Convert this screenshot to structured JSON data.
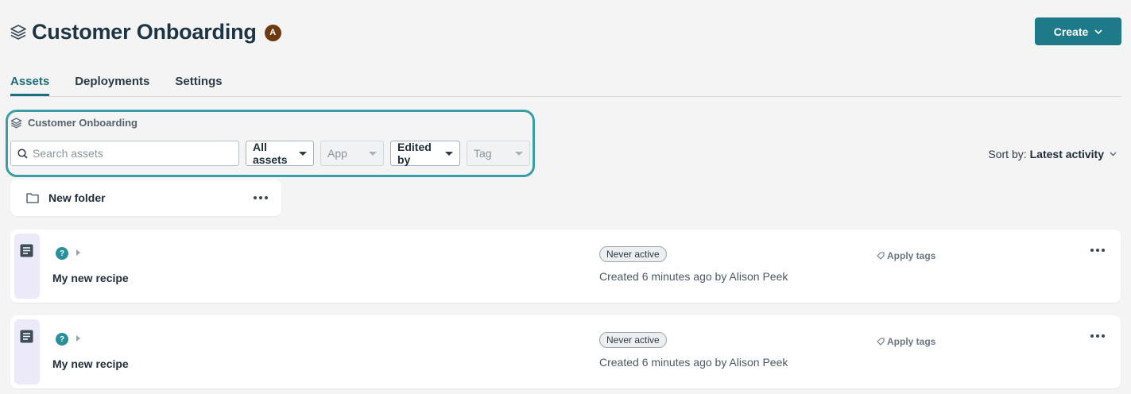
{
  "header": {
    "title": "Customer Onboarding",
    "avatar_initial": "A",
    "create_label": "Create"
  },
  "tabs": [
    {
      "label": "Assets",
      "active": true
    },
    {
      "label": "Deployments",
      "active": false
    },
    {
      "label": "Settings",
      "active": false
    }
  ],
  "filters": {
    "project_name": "Customer Onboarding",
    "search_placeholder": "Search assets",
    "search_value": "",
    "dropdowns": {
      "assets": "All assets",
      "app": "App",
      "edited_by": "Edited by",
      "tag": "Tag"
    },
    "sort_prefix": "Sort by:",
    "sort_value": "Latest activity"
  },
  "folder": {
    "name": "New folder"
  },
  "recipes": [
    {
      "name": "My new recipe",
      "status": "Never active",
      "created": "Created 6 minutes ago by Alison Peek",
      "tags_label": "Apply tags",
      "help_glyph": "?"
    },
    {
      "name": "My new recipe",
      "status": "Never active",
      "created": "Created 6 minutes ago by Alison Peek",
      "tags_label": "Apply tags",
      "help_glyph": "?"
    }
  ],
  "colors": {
    "accent": "#1e7a89",
    "highlight_border": "#3a9ea6",
    "avatar_bg": "#6b3a12",
    "recipe_sidebar": "#ece9f8"
  },
  "icons": {
    "project": "stack-icon",
    "search": "search-icon",
    "folder": "folder-icon",
    "recipe": "document-icon",
    "tags": "tag-icon",
    "more": "more-icon"
  }
}
